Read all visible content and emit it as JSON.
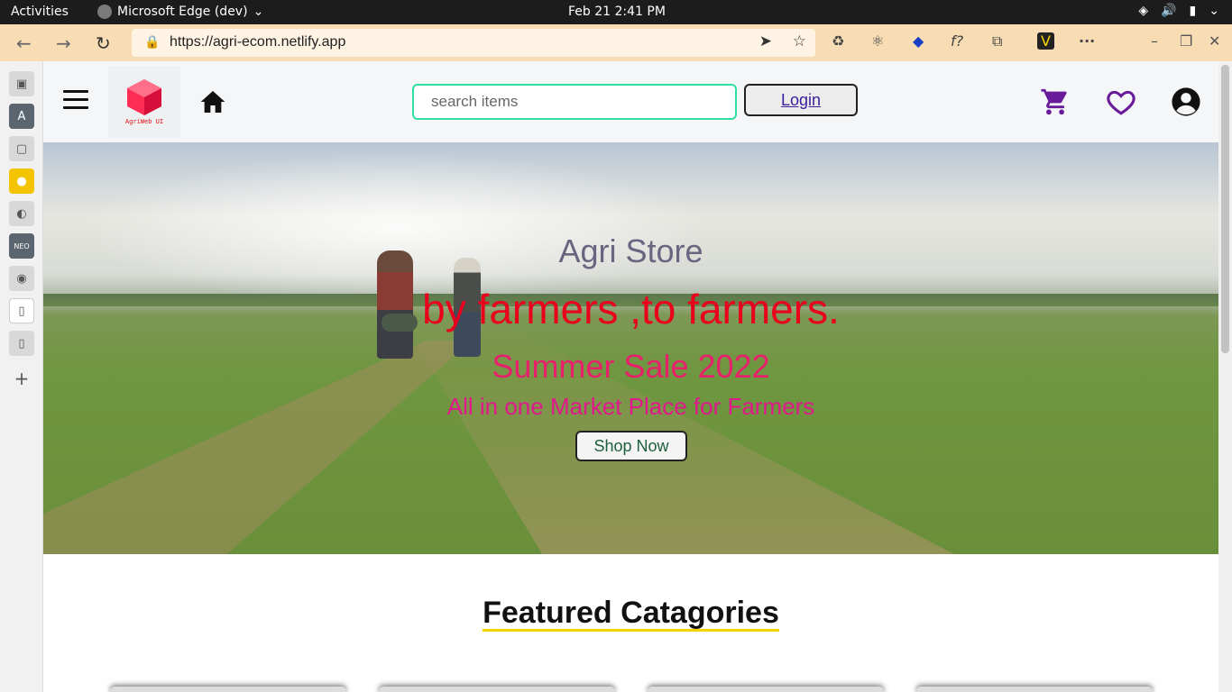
{
  "os": {
    "activities": "Activities",
    "app_name": "Microsoft Edge (dev)",
    "datetime": "Feb 21  2:41 PM"
  },
  "browser": {
    "url": "https://agri-ecom.netlify.app"
  },
  "site": {
    "logo_text": "AgriWeb UI",
    "search": {
      "placeholder": "search items",
      "value": ""
    },
    "login_label": "Login",
    "hero": {
      "title": "Agri Store",
      "tagline": "by farmers ,to farmers.",
      "sale": "Summer Sale 2022",
      "subtitle": "All in one Market Place for Farmers",
      "cta": "Shop Now"
    },
    "featured_heading": "Featured Catagories"
  },
  "colors": {
    "accent_purple": "#6a1b9a",
    "search_border": "#2de0a0",
    "tagline": "#e8001c",
    "sale": "#e81f6b",
    "heading_underline": "#f5d400"
  },
  "icons": {
    "cart": "cart-icon",
    "wishlist": "heart-icon",
    "account": "account-icon",
    "home": "home-icon",
    "menu": "hamburger-icon"
  }
}
